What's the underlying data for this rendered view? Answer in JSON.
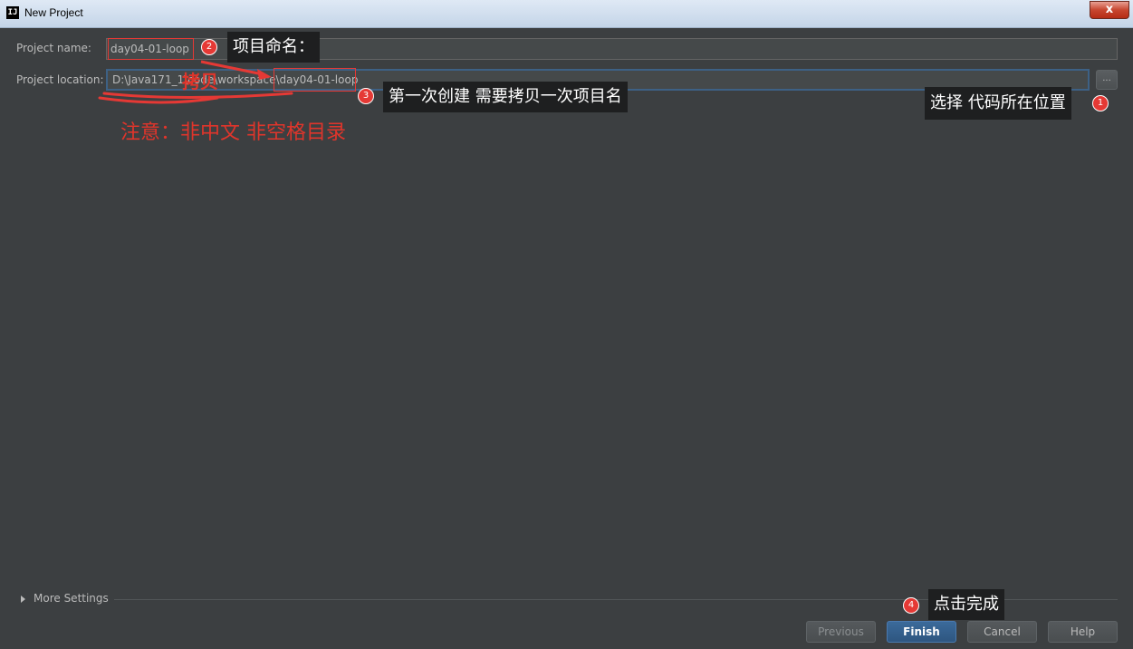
{
  "window": {
    "title": "New Project",
    "app_icon_text": "IJ",
    "close_glyph": "x"
  },
  "form": {
    "name_label": "Project name:",
    "name_value": "day04-01-loop",
    "location_label": "Project location:",
    "location_value": "D:\\Java171_1\\code\\workspace\\day04-01-loop",
    "browse_label": "..."
  },
  "annotations": {
    "step1": {
      "number": "1",
      "text": "选择 代码所在位置"
    },
    "step2": {
      "number": "2",
      "text": "项目命名："
    },
    "step3": {
      "number": "3",
      "text": "第一次创建  需要拷贝一次项目名"
    },
    "step4": {
      "number": "4",
      "text": "点击完成"
    },
    "copy_note": "拷贝",
    "warning": "注意：非中文  非空格目录",
    "accent_color": "#e53935"
  },
  "footer": {
    "more_settings": "More Settings",
    "buttons": {
      "previous": "Previous",
      "finish": "Finish",
      "cancel": "Cancel",
      "help": "Help"
    }
  }
}
